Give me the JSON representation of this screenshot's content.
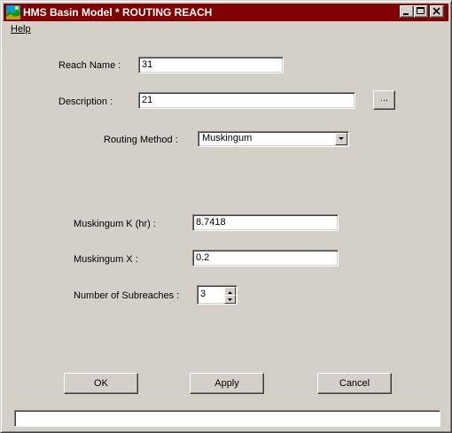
{
  "window": {
    "title": "HMS Basin Model * ROUTING REACH",
    "title_bar_color": "#800000"
  },
  "menu": {
    "help": "Help"
  },
  "form": {
    "reach_name_label": "Reach Name :",
    "reach_name_value": "31",
    "description_label": "Description :",
    "description_value": "21",
    "browse_button": "...",
    "routing_method_label": "Routing Method :",
    "routing_method_value": "Muskingum",
    "muskingum_k_label": "Muskingum K (hr) :",
    "muskingum_k_value": "8.7418",
    "muskingum_x_label": "Muskingum X :",
    "muskingum_x_value": "0.2",
    "subreaches_label": "Number of Subreaches :",
    "subreaches_value": "3"
  },
  "buttons": {
    "ok": "OK",
    "apply": "Apply",
    "cancel": "Cancel"
  },
  "status": {
    "text": ""
  },
  "icons": {
    "app": "hms-landscape-icon",
    "minimize": "minimize-icon",
    "maximize": "maximize-icon",
    "close": "close-icon",
    "dropdown": "chevron-down-icon",
    "spin_up": "arrow-up-icon",
    "spin_down": "arrow-down-icon"
  }
}
